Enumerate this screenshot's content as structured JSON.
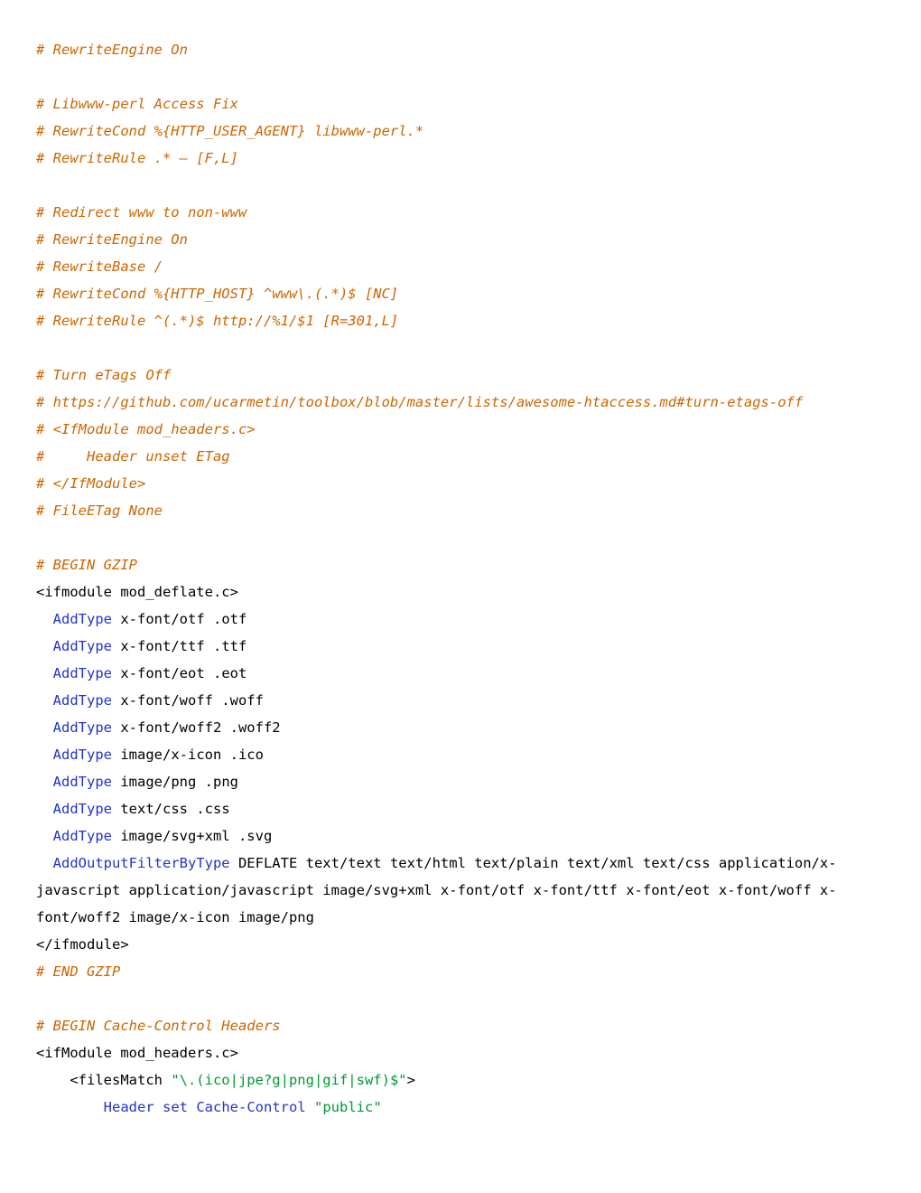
{
  "lines": [
    [
      [
        "c",
        "# RewriteEngine On"
      ]
    ],
    [
      [
        "",
        ""
      ]
    ],
    [
      [
        "c",
        "# Libwww-perl Access Fix"
      ]
    ],
    [
      [
        "c",
        "# RewriteCond %{HTTP_USER_AGENT} libwww-perl.*"
      ]
    ],
    [
      [
        "c",
        "# RewriteRule .* – [F,L]"
      ]
    ],
    [
      [
        "",
        ""
      ]
    ],
    [
      [
        "c",
        "# Redirect www to non-www"
      ]
    ],
    [
      [
        "c",
        "# RewriteEngine On"
      ]
    ],
    [
      [
        "c",
        "# RewriteBase /"
      ]
    ],
    [
      [
        "c",
        "# RewriteCond %{HTTP_HOST} ^www\\.(.*)$ [NC]"
      ]
    ],
    [
      [
        "c",
        "# RewriteRule ^(.*)$ http://%1/$1 [R=301,L]"
      ]
    ],
    [
      [
        "",
        ""
      ]
    ],
    [
      [
        "c",
        "# Turn eTags Off"
      ]
    ],
    [
      [
        "c",
        "# https://github.com/ucarmetin/toolbox/blob/master/lists/awesome-htaccess.md#turn-etags-off"
      ]
    ],
    [
      [
        "c",
        "# <IfModule mod_headers.c>"
      ]
    ],
    [
      [
        "c",
        "#     Header unset ETag"
      ]
    ],
    [
      [
        "c",
        "# </IfModule>"
      ]
    ],
    [
      [
        "c",
        "# FileETag None"
      ]
    ],
    [
      [
        "",
        ""
      ]
    ],
    [
      [
        "c",
        "# BEGIN GZIP"
      ]
    ],
    [
      [
        "tg",
        "<ifmodule mod_deflate.c>"
      ]
    ],
    [
      [
        "tg",
        "  "
      ],
      [
        "kw",
        "AddType"
      ],
      [
        "tg",
        " x-font/otf .otf"
      ]
    ],
    [
      [
        "tg",
        "  "
      ],
      [
        "kw",
        "AddType"
      ],
      [
        "tg",
        " x-font/ttf .ttf"
      ]
    ],
    [
      [
        "tg",
        "  "
      ],
      [
        "kw",
        "AddType"
      ],
      [
        "tg",
        " x-font/eot .eot"
      ]
    ],
    [
      [
        "tg",
        "  "
      ],
      [
        "kw",
        "AddType"
      ],
      [
        "tg",
        " x-font/woff .woff"
      ]
    ],
    [
      [
        "tg",
        "  "
      ],
      [
        "kw",
        "AddType"
      ],
      [
        "tg",
        " x-font/woff2 .woff2"
      ]
    ],
    [
      [
        "tg",
        "  "
      ],
      [
        "kw",
        "AddType"
      ],
      [
        "tg",
        " image/x-icon .ico"
      ]
    ],
    [
      [
        "tg",
        "  "
      ],
      [
        "kw",
        "AddType"
      ],
      [
        "tg",
        " image/png .png"
      ]
    ],
    [
      [
        "tg",
        "  "
      ],
      [
        "kw",
        "AddType"
      ],
      [
        "tg",
        " text/css .css"
      ]
    ],
    [
      [
        "tg",
        "  "
      ],
      [
        "kw",
        "AddType"
      ],
      [
        "tg",
        " image/svg+xml .svg"
      ]
    ],
    [
      [
        "tg",
        "  "
      ],
      [
        "kw",
        "AddOutputFilterByType"
      ],
      [
        "tg",
        " DEFLATE text/text text/html text/plain text/xml text/css application/x-javascript application/javascript image/svg+xml x-font/otf x-font/ttf x-font/eot x-font/woff x-font/woff2 image/x-icon image/png"
      ]
    ],
    [
      [
        "tg",
        "</ifmodule>"
      ]
    ],
    [
      [
        "c",
        "# END GZIP"
      ]
    ],
    [
      [
        "",
        ""
      ]
    ],
    [
      [
        "c",
        "# BEGIN Cache-Control Headers"
      ]
    ],
    [
      [
        "tg",
        "<ifModule mod_headers.c>"
      ]
    ],
    [
      [
        "tg",
        "    <filesMatch "
      ],
      [
        "st",
        "\"\\.(ico|jpe?g|png|gif|swf)$\""
      ],
      [
        "tg",
        ">"
      ]
    ],
    [
      [
        "tg",
        "        "
      ],
      [
        "p2",
        "Header"
      ],
      [
        "tg",
        " "
      ],
      [
        "p2",
        "set"
      ],
      [
        "tg",
        " "
      ],
      [
        "p2",
        "Cache-Control"
      ],
      [
        "tg",
        " "
      ],
      [
        "st",
        "\"public\""
      ]
    ]
  ]
}
